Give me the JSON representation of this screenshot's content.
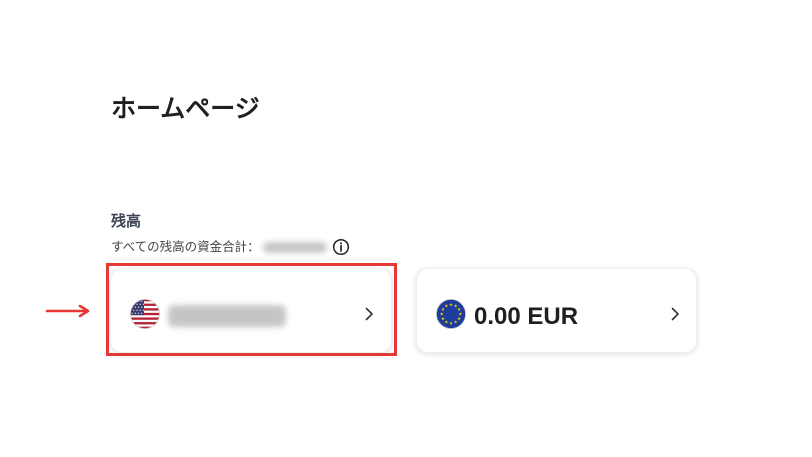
{
  "page": {
    "title": "ホームページ"
  },
  "balances": {
    "heading": "残高",
    "total_label": "すべての残高の資金合計：",
    "total_info_icon": "info-icon",
    "accounts": [
      {
        "currency_icon": "us-flag-icon",
        "chevron_icon": "chevron-right-icon"
      },
      {
        "currency_icon": "eu-flag-icon",
        "amount": "0.00 EUR",
        "chevron_icon": "chevron-right-icon"
      }
    ]
  },
  "annotation": {
    "arrow_icon": "arrow-right-icon"
  },
  "colors": {
    "highlight": "#e53935",
    "text": "#222222",
    "eu_blue": "#1d3c9b",
    "eu_star": "#f5d100",
    "us_red": "#b22234",
    "us_blue": "#3c3b6e"
  }
}
